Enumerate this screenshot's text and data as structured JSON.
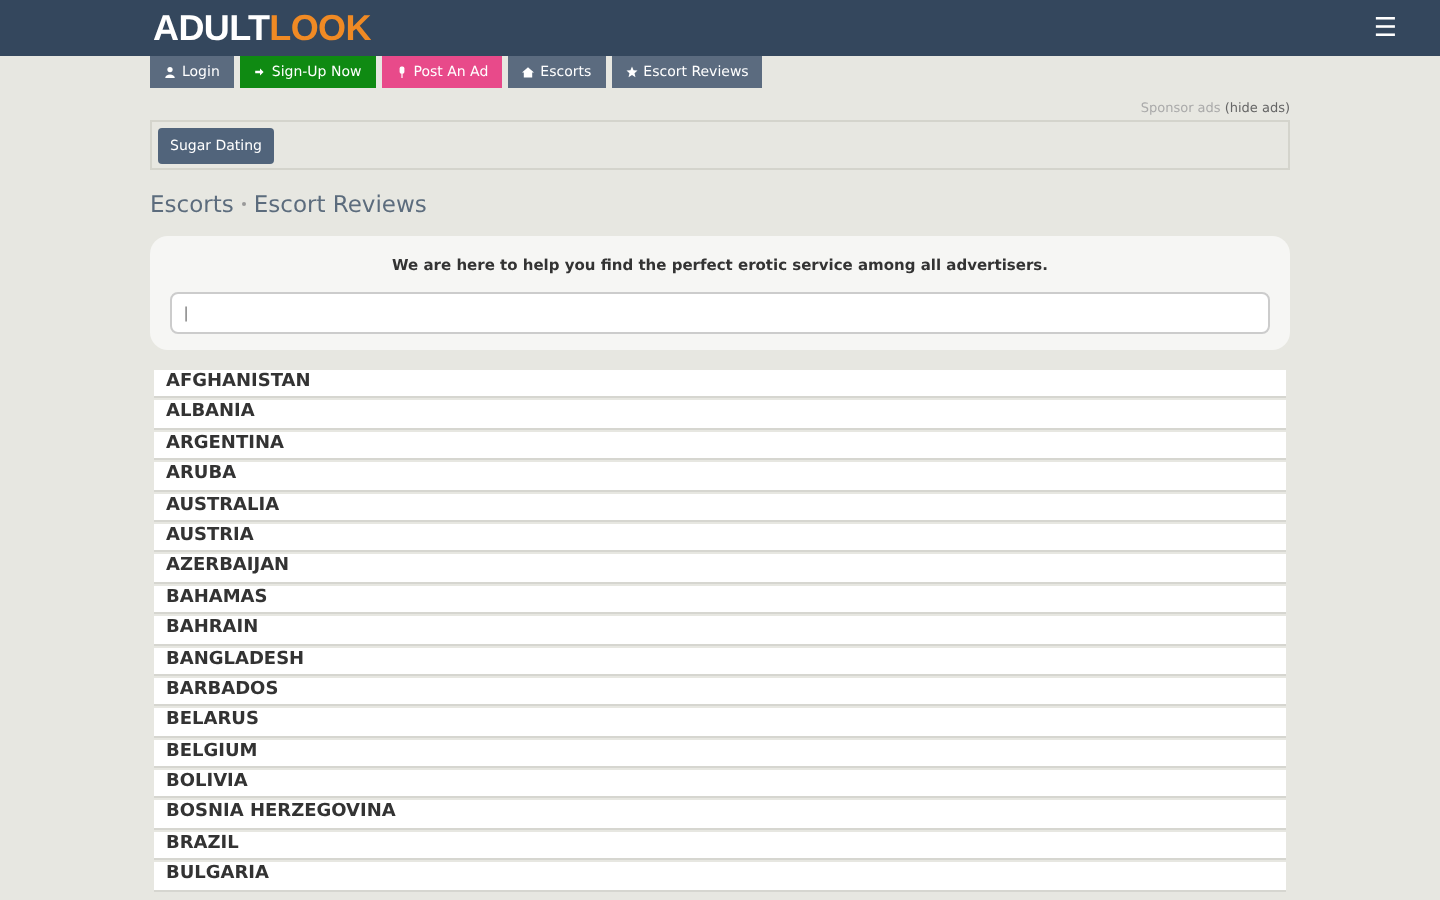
{
  "header": {
    "logo": {
      "first": "ADULT",
      "second": "LOOK"
    },
    "menu_icon": "☰"
  },
  "nav_buttons": [
    {
      "label": "Login",
      "kind": "user",
      "color": "#5b6b7f"
    },
    {
      "label": "Sign-Up Now",
      "kind": "signup",
      "color": "#0f8a12"
    },
    {
      "label": "Post An Ad",
      "kind": "post",
      "color": "#e84a8a"
    },
    {
      "label": "Escorts",
      "kind": "home",
      "color": "#5b6b7f"
    },
    {
      "label": "Escort Reviews",
      "kind": "star",
      "color": "#5b6b7f"
    }
  ],
  "sponsor": {
    "label": "Sponsor ads",
    "link": "(hide ads)"
  },
  "ad_buttons": [
    "Sugar Dating"
  ],
  "breadcrumb": [
    "Escorts",
    "Escort Reviews"
  ],
  "search_card": {
    "heading": "We are here to help you find the perfect erotic service among all advertisers.",
    "placeholder": "|"
  },
  "countries": [
    "AFGHANISTAN",
    "ALBANIA",
    "ARGENTINA",
    "ARUBA",
    "AUSTRALIA",
    "AUSTRIA",
    "AZERBAIJAN",
    "BAHAMAS",
    "BAHRAIN",
    "BANGLADESH",
    "BARBADOS",
    "BELARUS",
    "BELGIUM",
    "BOLIVIA",
    "BOSNIA HERZEGOVINA",
    "BRAZIL",
    "BULGARIA"
  ]
}
